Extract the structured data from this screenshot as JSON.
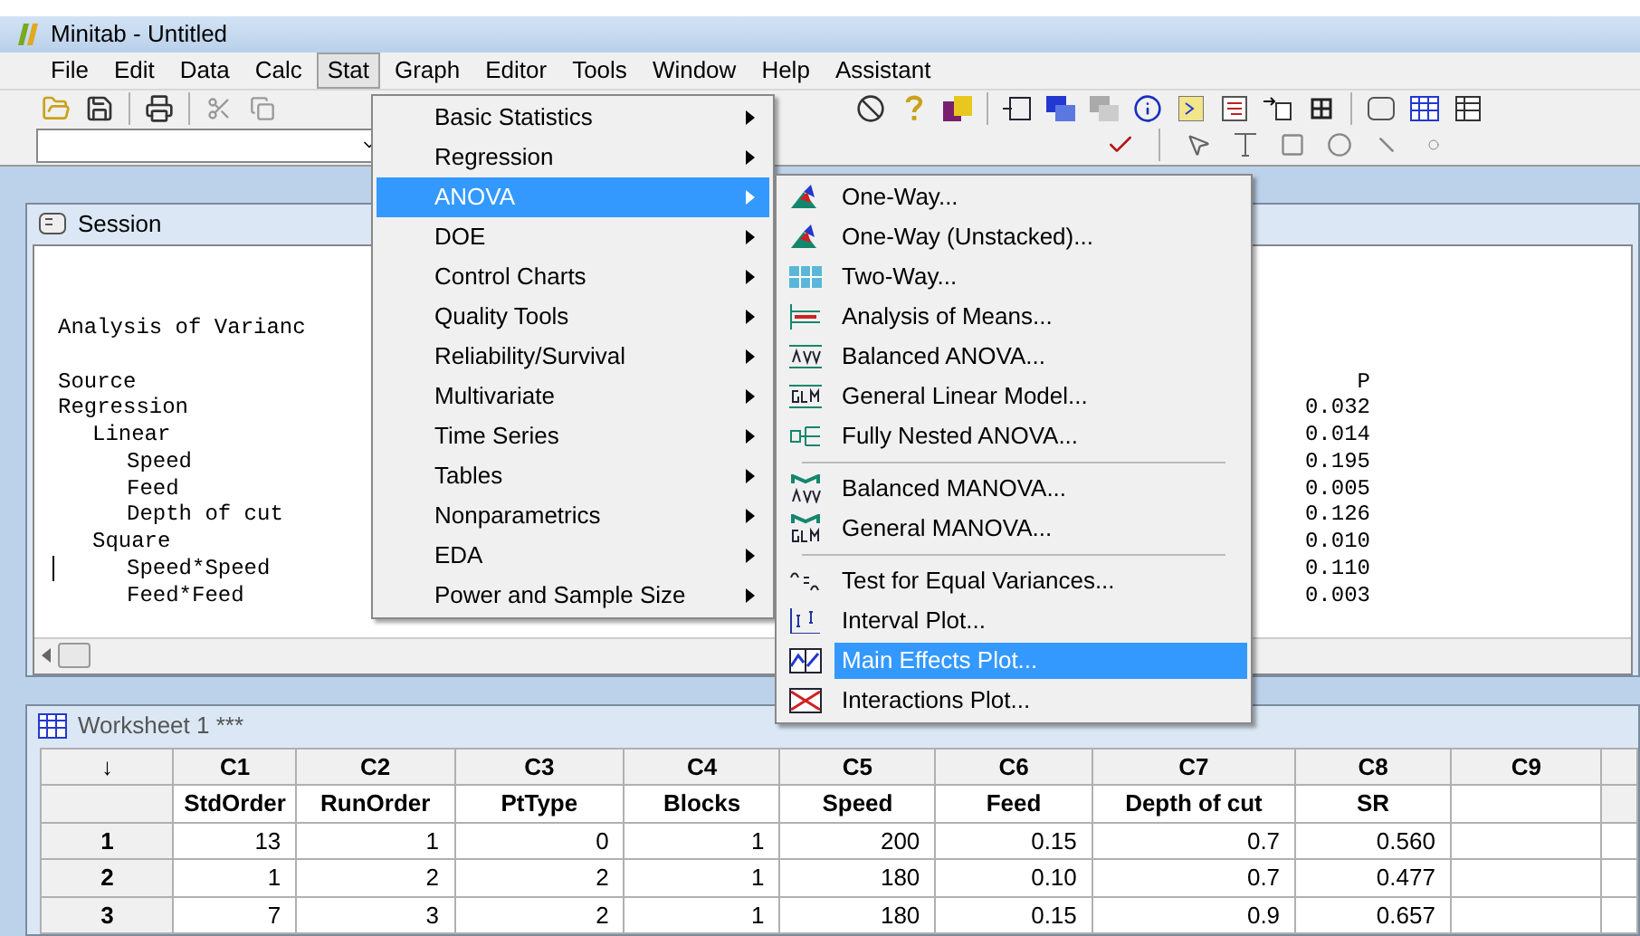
{
  "window": {
    "title": "Minitab - Untitled"
  },
  "menu_bar": [
    {
      "label": "File",
      "selected": false
    },
    {
      "label": "Edit",
      "selected": false
    },
    {
      "label": "Data",
      "selected": false
    },
    {
      "label": "Calc",
      "selected": false
    },
    {
      "label": "Stat",
      "selected": true
    },
    {
      "label": "Graph",
      "selected": false
    },
    {
      "label": "Editor",
      "selected": false
    },
    {
      "label": "Tools",
      "selected": false
    },
    {
      "label": "Window",
      "selected": false
    },
    {
      "label": "Help",
      "selected": false
    },
    {
      "label": "Assistant",
      "selected": false
    }
  ],
  "stat_menu": [
    {
      "label": "Basic Statistics",
      "selected": false
    },
    {
      "label": "Regression",
      "selected": false
    },
    {
      "label": "ANOVA",
      "selected": true
    },
    {
      "label": "DOE",
      "selected": false
    },
    {
      "label": "Control Charts",
      "selected": false
    },
    {
      "label": "Quality Tools",
      "selected": false
    },
    {
      "label": "Reliability/Survival",
      "selected": false
    },
    {
      "label": "Multivariate",
      "selected": false
    },
    {
      "label": "Time Series",
      "selected": false
    },
    {
      "label": "Tables",
      "selected": false
    },
    {
      "label": "Nonparametrics",
      "selected": false
    },
    {
      "label": "EDA",
      "selected": false
    },
    {
      "label": "Power and Sample Size",
      "selected": false
    }
  ],
  "anova_menu": [
    {
      "kind": "item",
      "label": "One-Way...",
      "selected": false
    },
    {
      "kind": "item",
      "label": "One-Way (Unstacked)...",
      "selected": false
    },
    {
      "kind": "item",
      "label": "Two-Way...",
      "selected": false
    },
    {
      "kind": "item",
      "label": "Analysis of Means...",
      "selected": false
    },
    {
      "kind": "item",
      "label": "Balanced ANOVA...",
      "selected": false
    },
    {
      "kind": "item",
      "label": "General Linear Model...",
      "selected": false
    },
    {
      "kind": "item",
      "label": "Fully Nested ANOVA...",
      "selected": false
    },
    {
      "kind": "separator"
    },
    {
      "kind": "item",
      "label": "Balanced MANOVA...",
      "selected": false
    },
    {
      "kind": "item",
      "label": "General MANOVA...",
      "selected": false
    },
    {
      "kind": "separator"
    },
    {
      "kind": "item",
      "label": "Test for Equal Variances...",
      "selected": false
    },
    {
      "kind": "item",
      "label": "Interval Plot...",
      "selected": false
    },
    {
      "kind": "item",
      "label": "Main Effects Plot...",
      "selected": true
    },
    {
      "kind": "item",
      "label": "Interactions Plot...",
      "selected": false
    }
  ],
  "session": {
    "title": "Session",
    "heading": "Analysis of Varianc",
    "source_header": "Source",
    "p_header": "P",
    "rows": [
      {
        "source": "Regression",
        "p": "0.032",
        "children": [
          {
            "source": "Linear",
            "p": "0.014",
            "children": [
              {
                "source": "Speed",
                "p": "0.195"
              },
              {
                "source": "Feed",
                "p": "0.005"
              },
              {
                "source": "Depth of cut",
                "p": "0.126"
              }
            ]
          },
          {
            "source": "Square",
            "p": "0.010",
            "children": [
              {
                "source": "Speed*Speed",
                "p": "0.110"
              },
              {
                "source": "Feed*Feed",
                "p": "0.003"
              }
            ]
          }
        ]
      }
    ]
  },
  "worksheet": {
    "title": "Worksheet 1 ***",
    "corner": "↓",
    "columns": [
      {
        "id": "C1",
        "name": "StdOrder"
      },
      {
        "id": "C2",
        "name": "RunOrder"
      },
      {
        "id": "C3",
        "name": "PtType"
      },
      {
        "id": "C4",
        "name": "Blocks"
      },
      {
        "id": "C5",
        "name": "Speed"
      },
      {
        "id": "C6",
        "name": "Feed"
      },
      {
        "id": "C7",
        "name": "Depth of cut"
      },
      {
        "id": "C8",
        "name": "SR"
      },
      {
        "id": "C9"
      }
    ],
    "rows": [
      {
        "num": "1",
        "cells": [
          "13",
          "1",
          "0",
          "1",
          "200",
          "0.15",
          "0.7",
          "0.560"
        ]
      },
      {
        "num": "2",
        "cells": [
          "1",
          "2",
          "2",
          "1",
          "180",
          "0.10",
          "0.7",
          "0.477"
        ]
      },
      {
        "num": "3",
        "cells": [
          "7",
          "3",
          "2",
          "1",
          "180",
          "0.15",
          "0.9",
          "0.657"
        ]
      }
    ]
  }
}
